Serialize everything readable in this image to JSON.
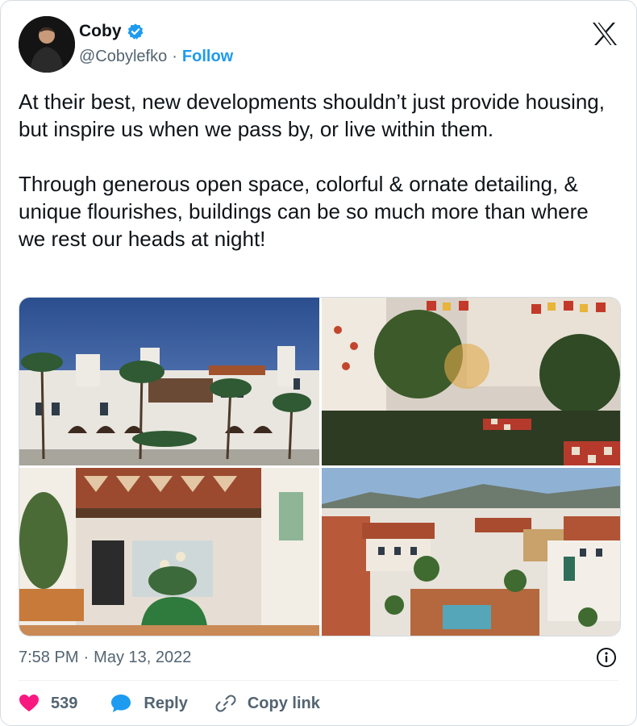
{
  "author": {
    "name": "Coby",
    "handle": "@Cobylefko",
    "separator": "·",
    "follow_label": "Follow",
    "verified_color": "#1d9bf0"
  },
  "platform_icon": "x-logo-icon",
  "tweet": {
    "paragraphs": [
      "At their best, new developments shouldn’t just provide housing, but inspire us when we pass by, or live within them.",
      "Through generous open space, colorful & ornate detailing, & unique flourishes, buildings can be so much more than where we rest our heads at night!"
    ]
  },
  "media": [
    {
      "icon": "photo-white-stucco-building-palms-dusk"
    },
    {
      "icon": "photo-courtyard-garden-tiles-night"
    },
    {
      "icon": "photo-archway-ornate-ceiling-planter"
    },
    {
      "icon": "photo-aerial-courtyard-mountains"
    }
  ],
  "meta": {
    "time": "7:58 PM",
    "separator": "·",
    "date": "May 13, 2022",
    "info_icon": "info-icon"
  },
  "actions": {
    "like_count": "539",
    "reply_label": "Reply",
    "copy_link_label": "Copy link",
    "like_color": "#f91880",
    "reply_color": "#1d9bf0"
  }
}
